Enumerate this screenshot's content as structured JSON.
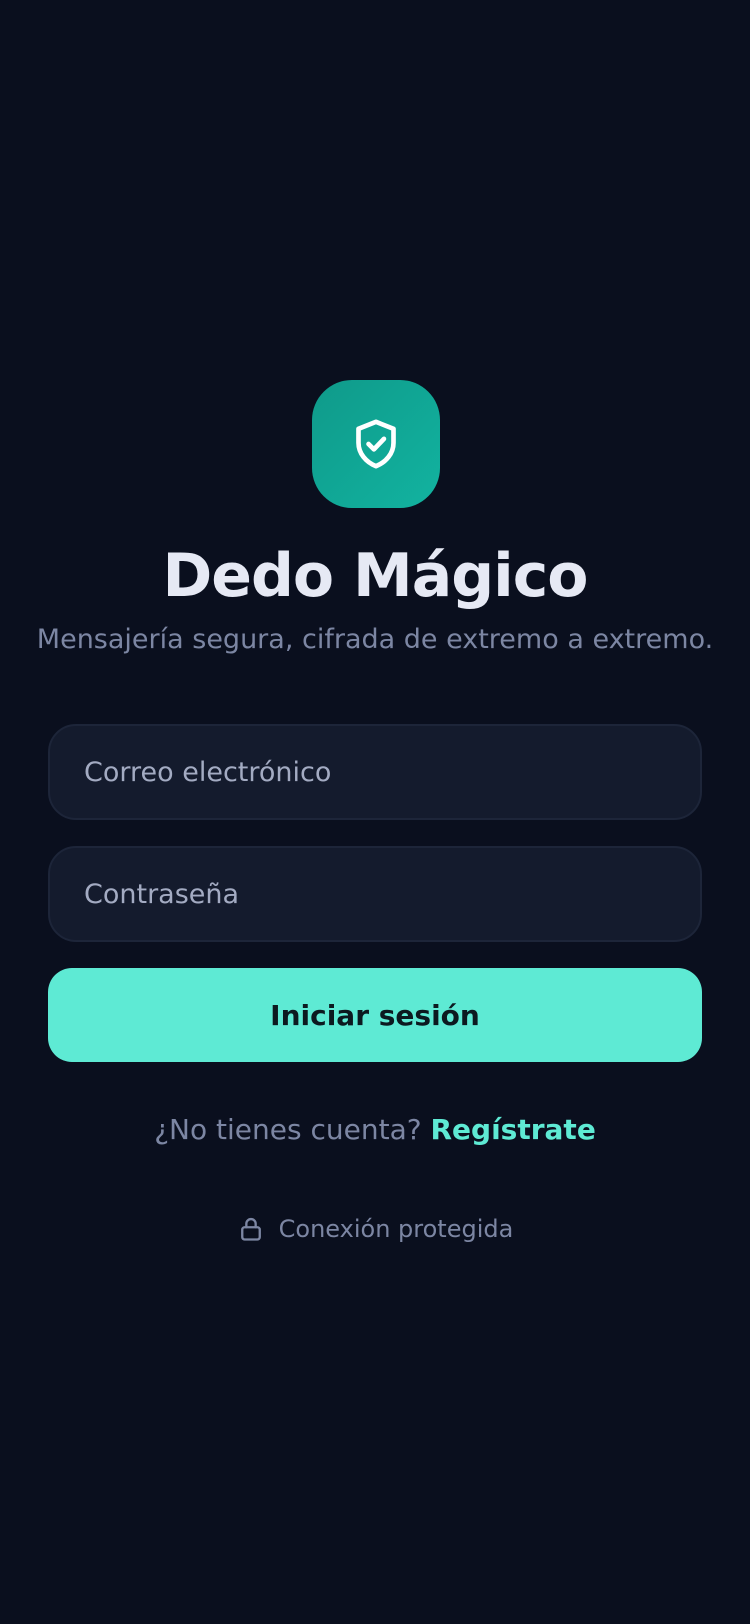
{
  "app": {
    "title": "Dedo Mágico",
    "tagline": "Mensajería segura, cifrada de extremo a extremo.",
    "logo_icon": "shield-check-icon"
  },
  "form": {
    "email_placeholder": "Correo electrónico",
    "email_value": "",
    "password_placeholder": "Contraseña",
    "password_value": "",
    "submit_label": "Iniciar sesión"
  },
  "signup": {
    "prompt": "¿No tienes cuenta?",
    "link_label": "Regístrate"
  },
  "security": {
    "icon": "lock-icon",
    "label": "Conexión protegida"
  },
  "colors": {
    "background": "#0a0f1e",
    "accent": "#5eead4",
    "logo_tile": "#12b3a0",
    "muted_text": "#7c86a3"
  }
}
